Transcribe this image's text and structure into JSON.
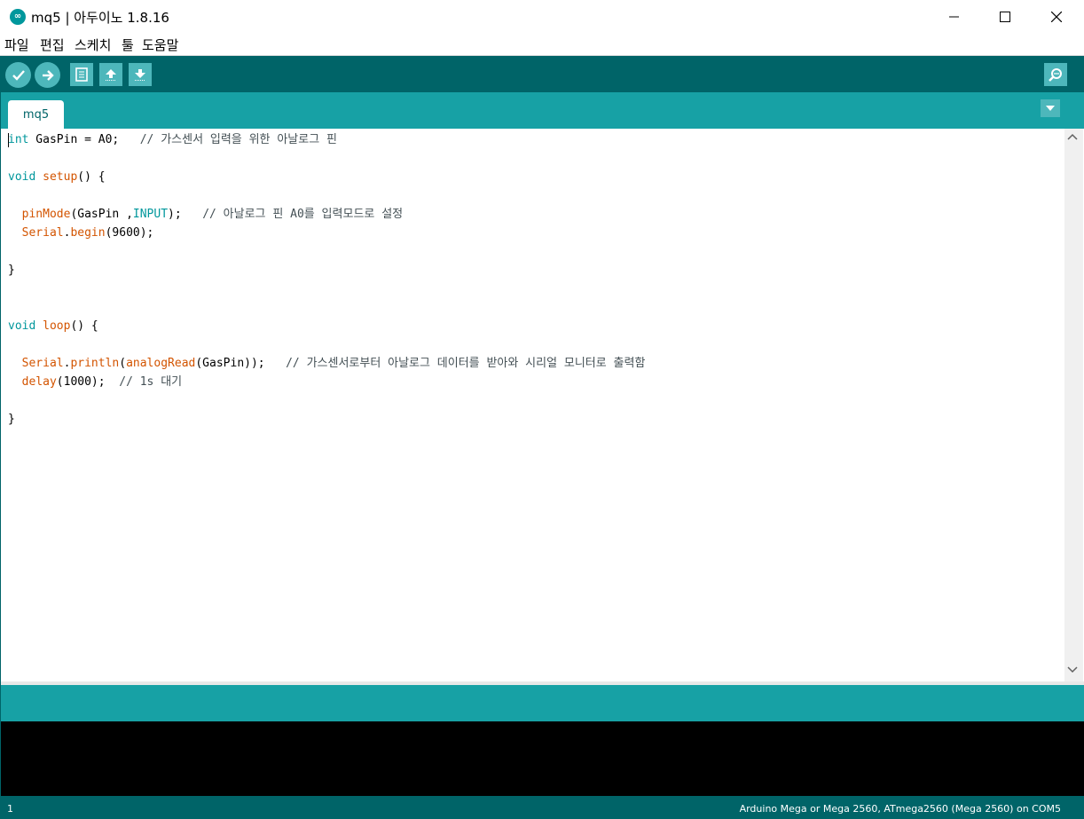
{
  "window": {
    "title": "mq5 | 아두이노 1.8.16",
    "icon": "infinity-icon",
    "controls": [
      "minimize-icon",
      "maximize-icon",
      "close-icon"
    ]
  },
  "menu": [
    "파일",
    "편집",
    "스케치",
    "툴",
    "도움말"
  ],
  "toolbar": {
    "buttons": [
      "verify-icon",
      "upload-icon",
      "new-icon",
      "open-icon",
      "save-icon",
      "serial-monitor-icon"
    ]
  },
  "tab": {
    "label": "mq5"
  },
  "code": {
    "line1": {
      "kw": "int",
      "rest": " GasPin = A0;   ",
      "comment": "// 가스센서 입력을 위한 아날로그 핀"
    },
    "line3": {
      "kw": "void",
      "sp": " ",
      "fn": "setup",
      "rest": "() {"
    },
    "line5": {
      "indent": "  ",
      "fn": "pinMode",
      "a": "(GasPin ,",
      "kw": "INPUT",
      "b": ");   ",
      "comment": "// 아날로그 핀 A0를 입력모드로 설정"
    },
    "line6": {
      "indent": "  ",
      "fn1": "Serial",
      "dot": ".",
      "fn2": "begin",
      "rest": "(9600);"
    },
    "line8": {
      "text": "}"
    },
    "line11": {
      "kw": "void",
      "sp": " ",
      "fn": "loop",
      "rest": "() {"
    },
    "line13": {
      "indent": "  ",
      "fn1": "Serial",
      "dot": ".",
      "fn2": "println",
      "p": "(",
      "fn3": "analogRead",
      "rest": "(GasPin));   ",
      "comment": "// 가스센서로부터 아날로그 데이터를 받아와 시리얼 모니터로 출력함"
    },
    "line14": {
      "indent": "  ",
      "fn": "delay",
      "rest": "(1000);  ",
      "comment": "// 1s 대기"
    },
    "line16": {
      "text": "}"
    }
  },
  "status": {
    "line_number": "1",
    "board": "Arduino Mega or Mega 2560, ATmega2560 (Mega 2560) on COM5"
  },
  "colors": {
    "toolbar": "#006468",
    "tabbar": "#17a1a5",
    "button": "#4db7bb",
    "keyword": "#00979c",
    "function": "#d35400",
    "console": "#000000"
  }
}
